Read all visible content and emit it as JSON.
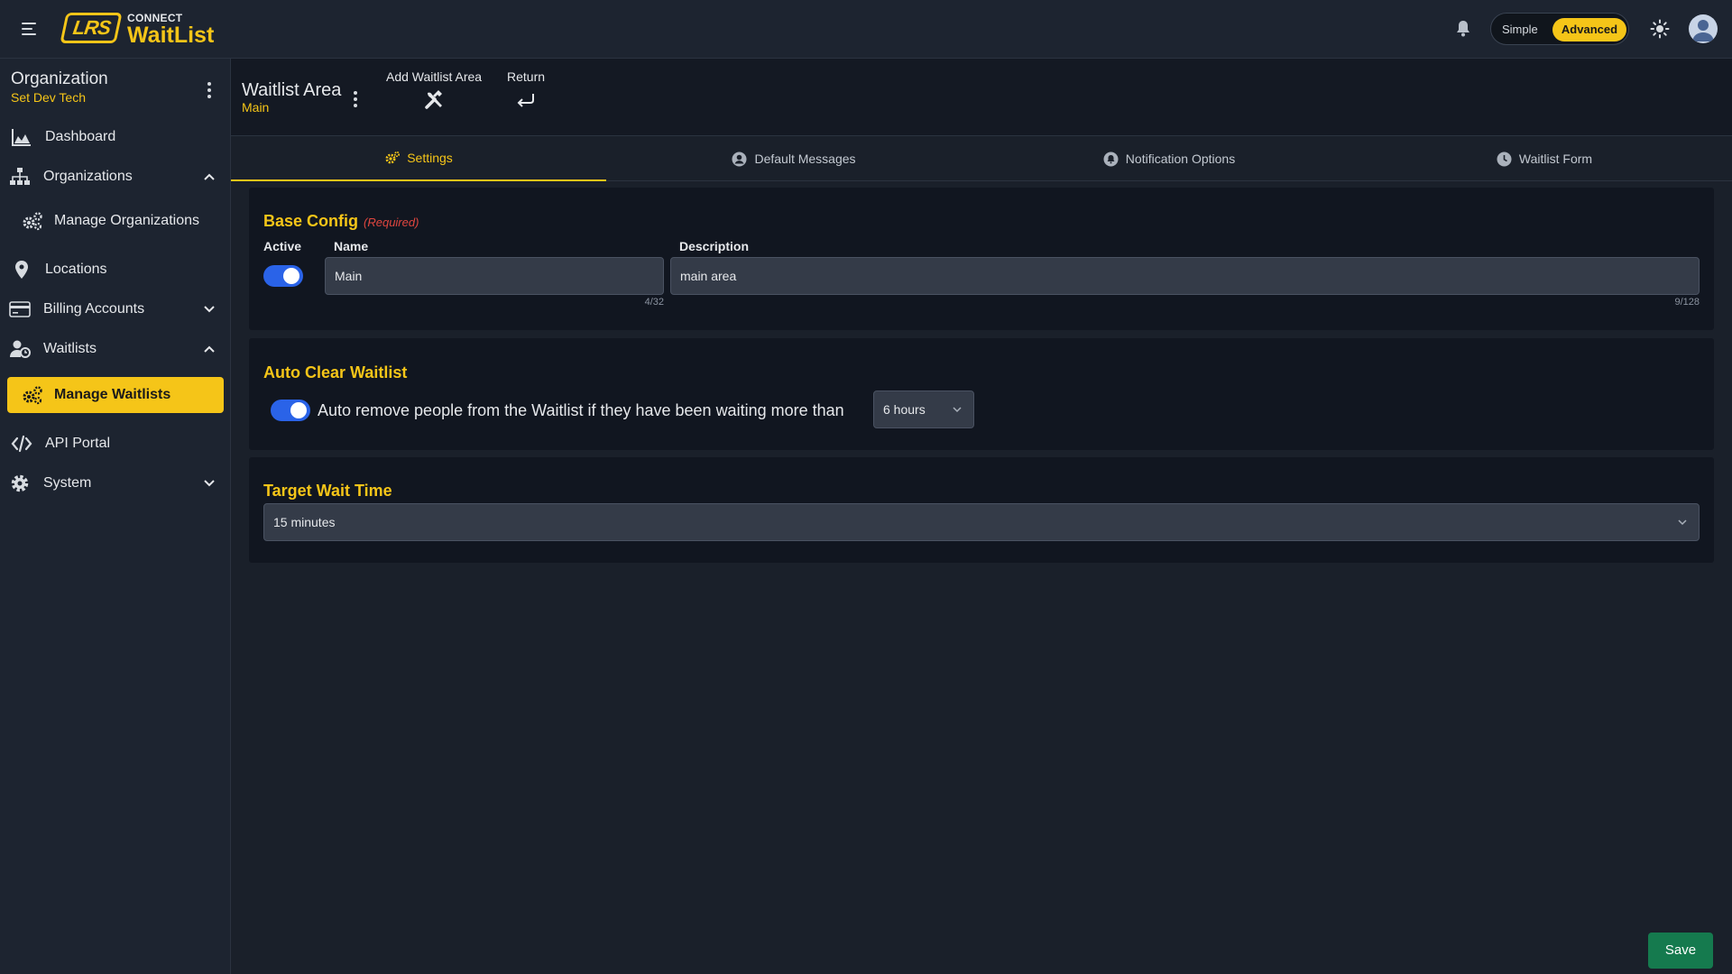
{
  "header": {
    "brand_top": "CONNECT",
    "brand_name": "WaitList",
    "logo_text": "LRS",
    "mode_simple": "Simple",
    "mode_advanced": "Advanced",
    "mode_selected": "Advanced"
  },
  "sidebar": {
    "org_title": "Organization",
    "org_sub": "Set Dev Tech",
    "items": [
      {
        "label": "Dashboard",
        "icon": "chart-area-icon"
      },
      {
        "label": "Organizations",
        "icon": "sitemap-icon",
        "expanded": true
      },
      {
        "label": "Manage Organizations",
        "icon": "gears-icon"
      },
      {
        "label": "Locations",
        "icon": "map-pin-icon"
      },
      {
        "label": "Billing Accounts",
        "icon": "credit-card-icon",
        "expanded": false
      },
      {
        "label": "Waitlists",
        "icon": "user-clock-icon",
        "expanded": true
      },
      {
        "label": "Manage Waitlists",
        "icon": "gears-icon",
        "active": true
      },
      {
        "label": "API Portal",
        "icon": "code-icon"
      },
      {
        "label": "System",
        "icon": "gear-icon",
        "expanded": false
      }
    ]
  },
  "subheader": {
    "title": "Waitlist Area",
    "subtitle": "Main",
    "add_label": "Add Waitlist Area",
    "return_label": "Return"
  },
  "tabs": [
    {
      "label": "Settings",
      "icon": "gear-icon",
      "active": true
    },
    {
      "label": "Default Messages",
      "icon": "user-circle-icon"
    },
    {
      "label": "Notification Options",
      "icon": "bell-circle-icon"
    },
    {
      "label": "Waitlist Form",
      "icon": "clock-icon"
    }
  ],
  "base_config": {
    "title": "Base Config",
    "required": "(Required)",
    "active_label": "Active",
    "active": true,
    "name_label": "Name",
    "name_value": "Main",
    "name_counter": "4/32",
    "description_label": "Description",
    "description_value": "main area",
    "description_counter": "9/128"
  },
  "auto_clear": {
    "title": "Auto Clear Waitlist",
    "enabled": true,
    "text": "Auto remove people from the Waitlist if they have been waiting more than",
    "duration": "6 hours"
  },
  "target_wait": {
    "title": "Target Wait Time",
    "value": "15 minutes"
  },
  "save_label": "Save",
  "colors": {
    "accent": "#f5c518",
    "toggle": "#2a63e8",
    "save": "#157a4e",
    "required": "#e0463f"
  }
}
